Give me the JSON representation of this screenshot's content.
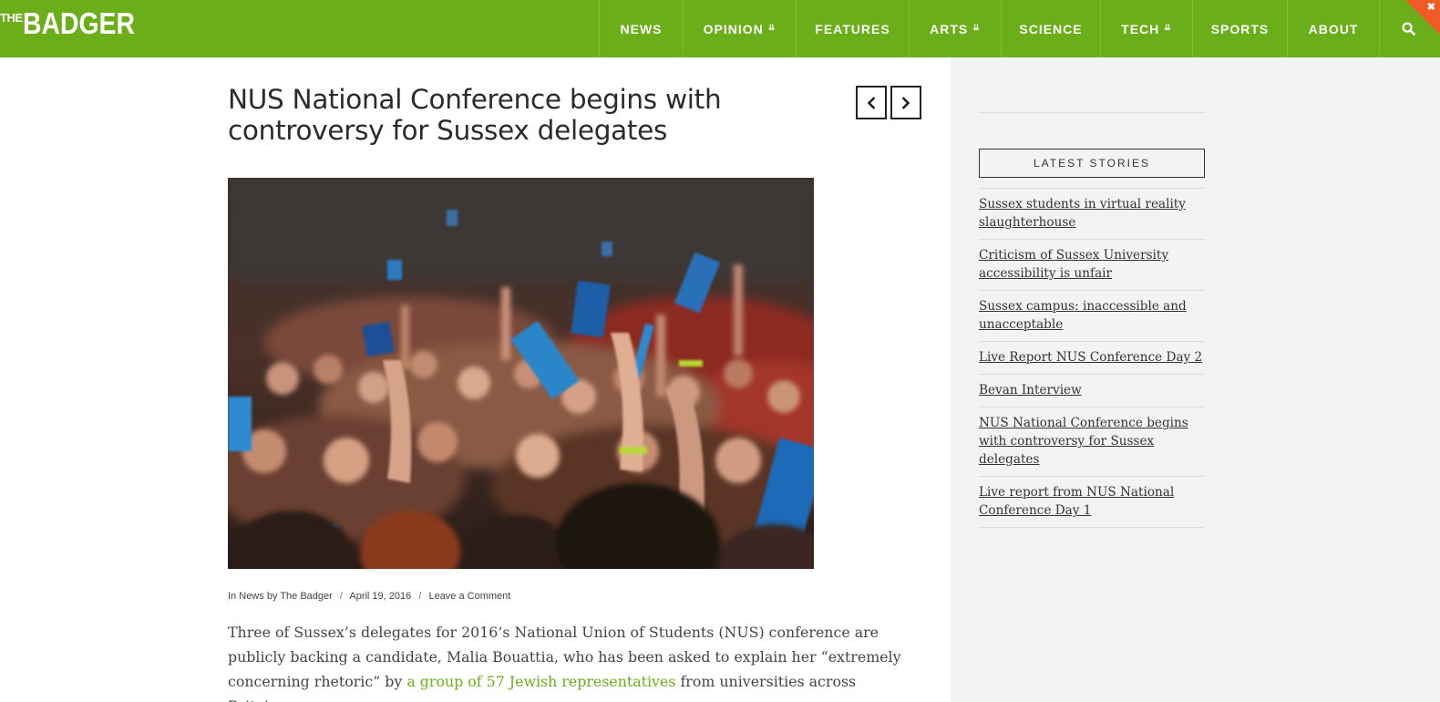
{
  "site": {
    "logo_the": "THE",
    "logo_badger": "BADGER"
  },
  "nav": {
    "items": [
      {
        "label": "NEWS",
        "has_dropdown": false
      },
      {
        "label": "OPINION",
        "has_dropdown": true
      },
      {
        "label": "FEATURES",
        "has_dropdown": false
      },
      {
        "label": "ARTS",
        "has_dropdown": true
      },
      {
        "label": "SCIENCE",
        "has_dropdown": false
      },
      {
        "label": "TECH",
        "has_dropdown": true
      },
      {
        "label": "SPORTS",
        "has_dropdown": false
      },
      {
        "label": "ABOUT",
        "has_dropdown": false
      }
    ],
    "search_icon": "search-icon",
    "chevron_icon": "double-chevron-down-icon"
  },
  "article": {
    "title": "NUS National Conference begins with controversy for Sussex delegates",
    "meta": {
      "in_label": "In",
      "category": "News",
      "by_label": "by",
      "author": "The Badger",
      "date": "April 19, 2016",
      "comment_link": "Leave a Comment"
    },
    "body_before_link": "Three of Sussex’s delegates for 2016’s National Union of Students (NUS) conference are publicly backing a candidate, Malia Bouattia, who has been asked to explain her “extremely concerning rhetoric” by ",
    "body_link": "a group of 57 Jewish representatives",
    "body_after_link": " from universities across Britain."
  },
  "sidebar": {
    "heading": "LATEST STORIES",
    "stories": [
      "Sussex students in virtual reality slaughterhouse",
      "Criticism of Sussex University accessibility is unfair",
      "Sussex campus: inaccessible and unacceptable",
      "Live Report NUS Conference Day 2",
      "Bevan Interview",
      "NUS National Conference begins with controversy for Sussex delegates",
      "Live report from NUS National Conference Day 1"
    ]
  },
  "colors": {
    "brand_green": "#6aaf19",
    "sidebar_bg": "#f3f3f3",
    "corner_accent": "#f05b26"
  }
}
